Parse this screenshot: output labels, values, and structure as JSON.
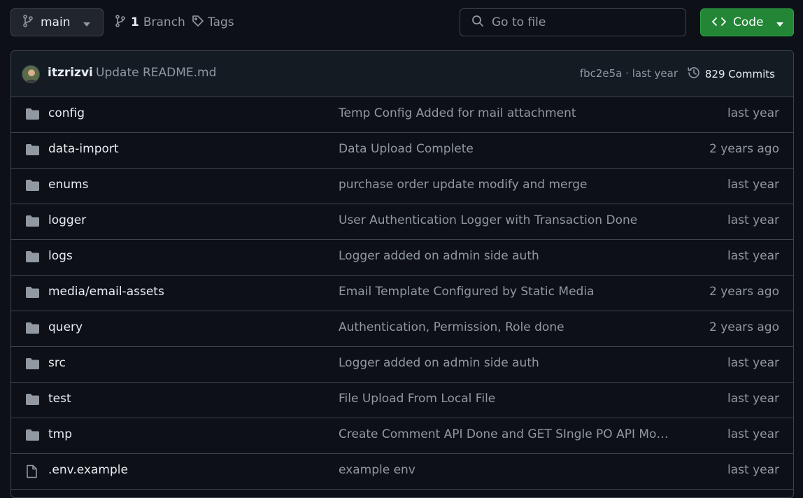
{
  "toolbar": {
    "branch_label": "main",
    "branch_count": "1",
    "branch_text": "Branch",
    "tags_text": "Tags",
    "search_placeholder": "Go to file",
    "code_label": "Code"
  },
  "commit": {
    "author": "itzrizvi",
    "message": "Update README.md",
    "meta": "fbc2e5a · last year",
    "commits_count_text": "829 Commits"
  },
  "files": [
    {
      "type": "folder",
      "name": "config",
      "message": "Temp Config Added for mail attachment",
      "time": "last year"
    },
    {
      "type": "folder",
      "name": "data-import",
      "message": "Data Upload Complete",
      "time": "2 years ago"
    },
    {
      "type": "folder",
      "name": "enums",
      "message": "purchase order update modify and merge",
      "time": "last year"
    },
    {
      "type": "folder",
      "name": "logger",
      "message": "User Authentication Logger with Transaction Done",
      "time": "last year"
    },
    {
      "type": "folder",
      "name": "logs",
      "message": "Logger added on admin side auth",
      "time": "last year"
    },
    {
      "type": "folder",
      "name": "media/email-assets",
      "message": "Email Template Configured by Static Media",
      "time": "2 years ago"
    },
    {
      "type": "folder",
      "name": "query",
      "message": "Authentication, Permission, Role done",
      "time": "2 years ago"
    },
    {
      "type": "folder",
      "name": "src",
      "message": "Logger added on admin side auth",
      "time": "last year"
    },
    {
      "type": "folder",
      "name": "test",
      "message": "File Upload From Local File",
      "time": "last year"
    },
    {
      "type": "folder",
      "name": "tmp",
      "message": "Create Comment API Done and GET SIngle PO API Modi...",
      "time": "last year"
    },
    {
      "type": "file",
      "name": ".env.example",
      "message": "example env",
      "time": "last year"
    }
  ],
  "colors": {
    "background": "#0d1117",
    "border": "#3d444d",
    "muted_text": "#9198a1",
    "primary_text": "#e6edf3",
    "code_button": "#238636",
    "folder_icon": "#9198a1"
  },
  "icons": {
    "branch": "git-branch-icon",
    "caret": "triangle-down-icon",
    "tag": "tag-icon",
    "search": "search-icon",
    "code": "code-icon",
    "history": "history-icon",
    "folder": "folder-icon",
    "file": "file-icon"
  }
}
